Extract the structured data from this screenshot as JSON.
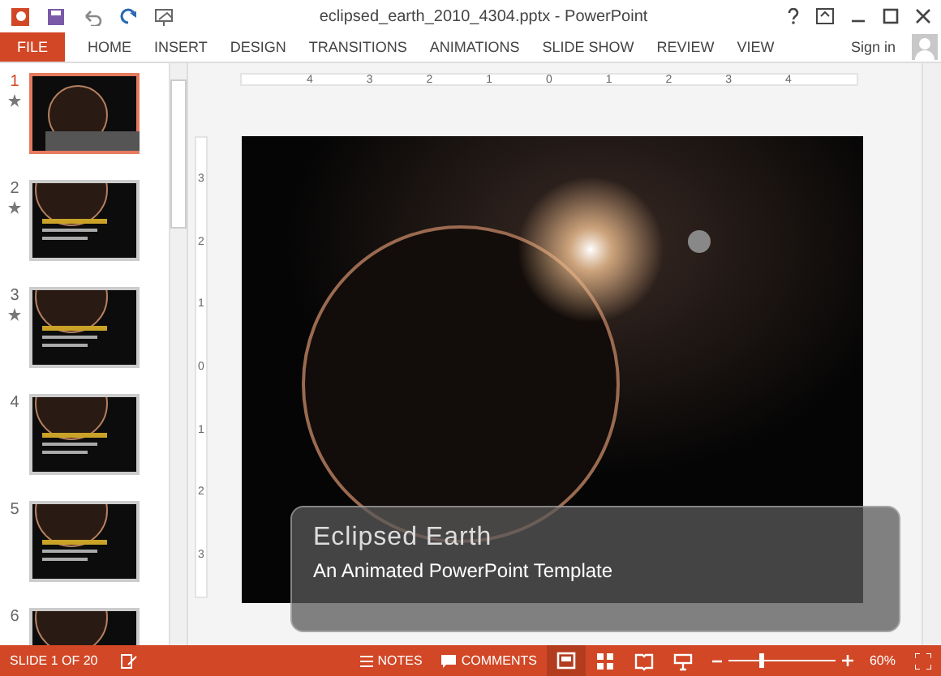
{
  "window": {
    "title": "eclipsed_earth_2010_4304.pptx - PowerPoint"
  },
  "ribbon": {
    "file_tab": "FILE",
    "tabs": [
      "HOME",
      "INSERT",
      "DESIGN",
      "TRANSITIONS",
      "ANIMATIONS",
      "SLIDE SHOW",
      "REVIEW",
      "VIEW"
    ],
    "sign_in": "Sign in"
  },
  "thumbnails": [
    {
      "number": "1",
      "selected": true,
      "animated": true
    },
    {
      "number": "2",
      "selected": false,
      "animated": true
    },
    {
      "number": "3",
      "selected": false,
      "animated": true
    },
    {
      "number": "4",
      "selected": false,
      "animated": false
    },
    {
      "number": "5",
      "selected": false,
      "animated": false
    },
    {
      "number": "6",
      "selected": false,
      "animated": false
    }
  ],
  "rulers": {
    "horizontal": [
      "4",
      "3",
      "2",
      "1",
      "0",
      "1",
      "2",
      "3",
      "4"
    ],
    "vertical": [
      "3",
      "2",
      "1",
      "0",
      "1",
      "2",
      "3"
    ]
  },
  "slide": {
    "title": "Eclipsed Earth",
    "subtitle": "An Animated PowerPoint Template"
  },
  "status_bar": {
    "slide_counter": "SLIDE 1 OF 20",
    "notes": "NOTES",
    "comments": "COMMENTS",
    "views": [
      {
        "kind": "normal",
        "selected": true
      },
      {
        "kind": "sorter",
        "selected": false
      },
      {
        "kind": "reading",
        "selected": false
      },
      {
        "kind": "slideshow",
        "selected": false
      }
    ],
    "zoom": {
      "level": 0.29,
      "reading": "60%"
    }
  }
}
